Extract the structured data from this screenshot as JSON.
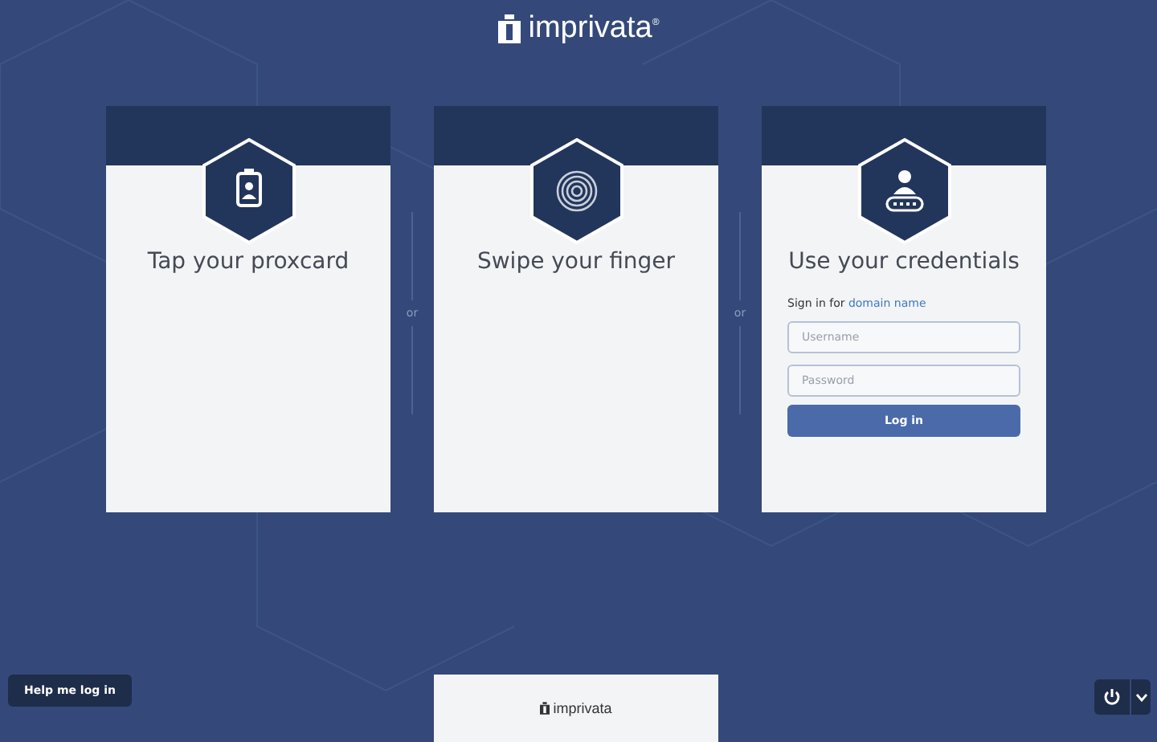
{
  "logo": {
    "text": "imprivata$^{®}$"
  },
  "methods": [
    {
      "kind": "proxcard",
      "title": "Tap your proxcard"
    },
    {
      "kind": "fingerprint",
      "title": "Swipe your finger"
    },
    {
      "kind": "credentials",
      "title": "Use your credentials",
      "sign_in_label": "Sign in for",
      "domain_link": "domain name",
      "username": {
        "placeholder": "Username"
      },
      "password": {
        "placeholder": "Password"
      },
      "login_button": "Log in"
    }
  ],
  "separators": [
    "or",
    "or"
  ],
  "footer": {
    "help_button": "Help me log in",
    "logo_text": "imprivata"
  }
}
